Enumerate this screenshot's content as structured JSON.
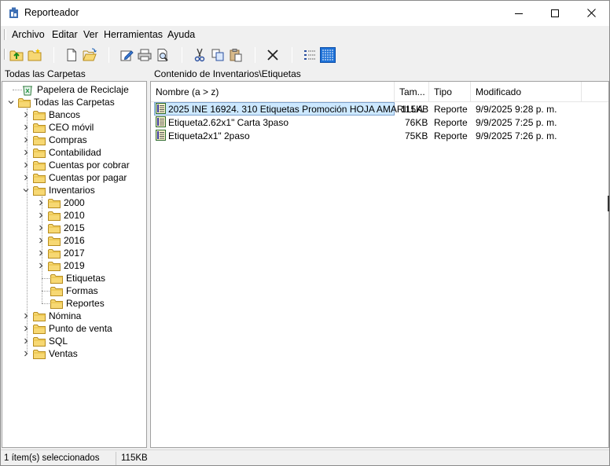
{
  "window": {
    "title": "Reporteador"
  },
  "menu": [
    "Archivo",
    "Editar",
    "Ver",
    "Herramientas",
    "Ayuda"
  ],
  "toolbar": {
    "icons": [
      "up-folder-icon",
      "new-folder-icon",
      "new-document-icon",
      "open-folder-icon",
      "edit-icon",
      "print-icon",
      "print-preview-icon",
      "cut-icon",
      "copy-icon",
      "paste-icon",
      "delete-icon",
      "list-view-icon",
      "details-view-icon"
    ]
  },
  "tree": {
    "header": "Todas las Carpetas",
    "recycle": "Papelera de Reciclaje",
    "root": "Todas las Carpetas",
    "folders": [
      "Bancos",
      "CEO móvil",
      "Compras",
      "Contabilidad",
      "Cuentas por cobrar",
      "Cuentas por pagar",
      "Inventarios"
    ],
    "inventarios_children": [
      "2000",
      "2010",
      "2015",
      "2016",
      "2017",
      "2019",
      "Etiquetas",
      "Formas",
      "Reportes"
    ],
    "folders_after": [
      "Nómina",
      "Punto de venta",
      "SQL",
      "Ventas"
    ]
  },
  "list": {
    "header": "Contenido de Inventarios\\Etiquetas",
    "columns": [
      "Nombre (a > z)",
      "Tam...",
      "Tipo",
      "Modificado"
    ],
    "rows": [
      {
        "name": "2025 INE 16924. 310 Etiquetas Promoción HOJA AMARILLA",
        "size": "115KB",
        "type": "Reporte",
        "modified": "9/9/2025 9:28 p. m."
      },
      {
        "name": "Etiqueta2.62x1\" Carta 3paso",
        "size": "76KB",
        "type": "Reporte",
        "modified": "9/9/2025 7:25 p. m."
      },
      {
        "name": "Etiqueta2x1\" 2paso",
        "size": "75KB",
        "type": "Reporte",
        "modified": "9/9/2025 7:26 p. m."
      }
    ]
  },
  "status": {
    "selected": "1 ítem(s) seleccionados",
    "size": "115KB"
  },
  "colors": {
    "selection_bg": "#cce8ff",
    "selection_border": "#7da2ce",
    "folder_yellow": "#f3d060",
    "accent_blue": "#1e72d8"
  }
}
